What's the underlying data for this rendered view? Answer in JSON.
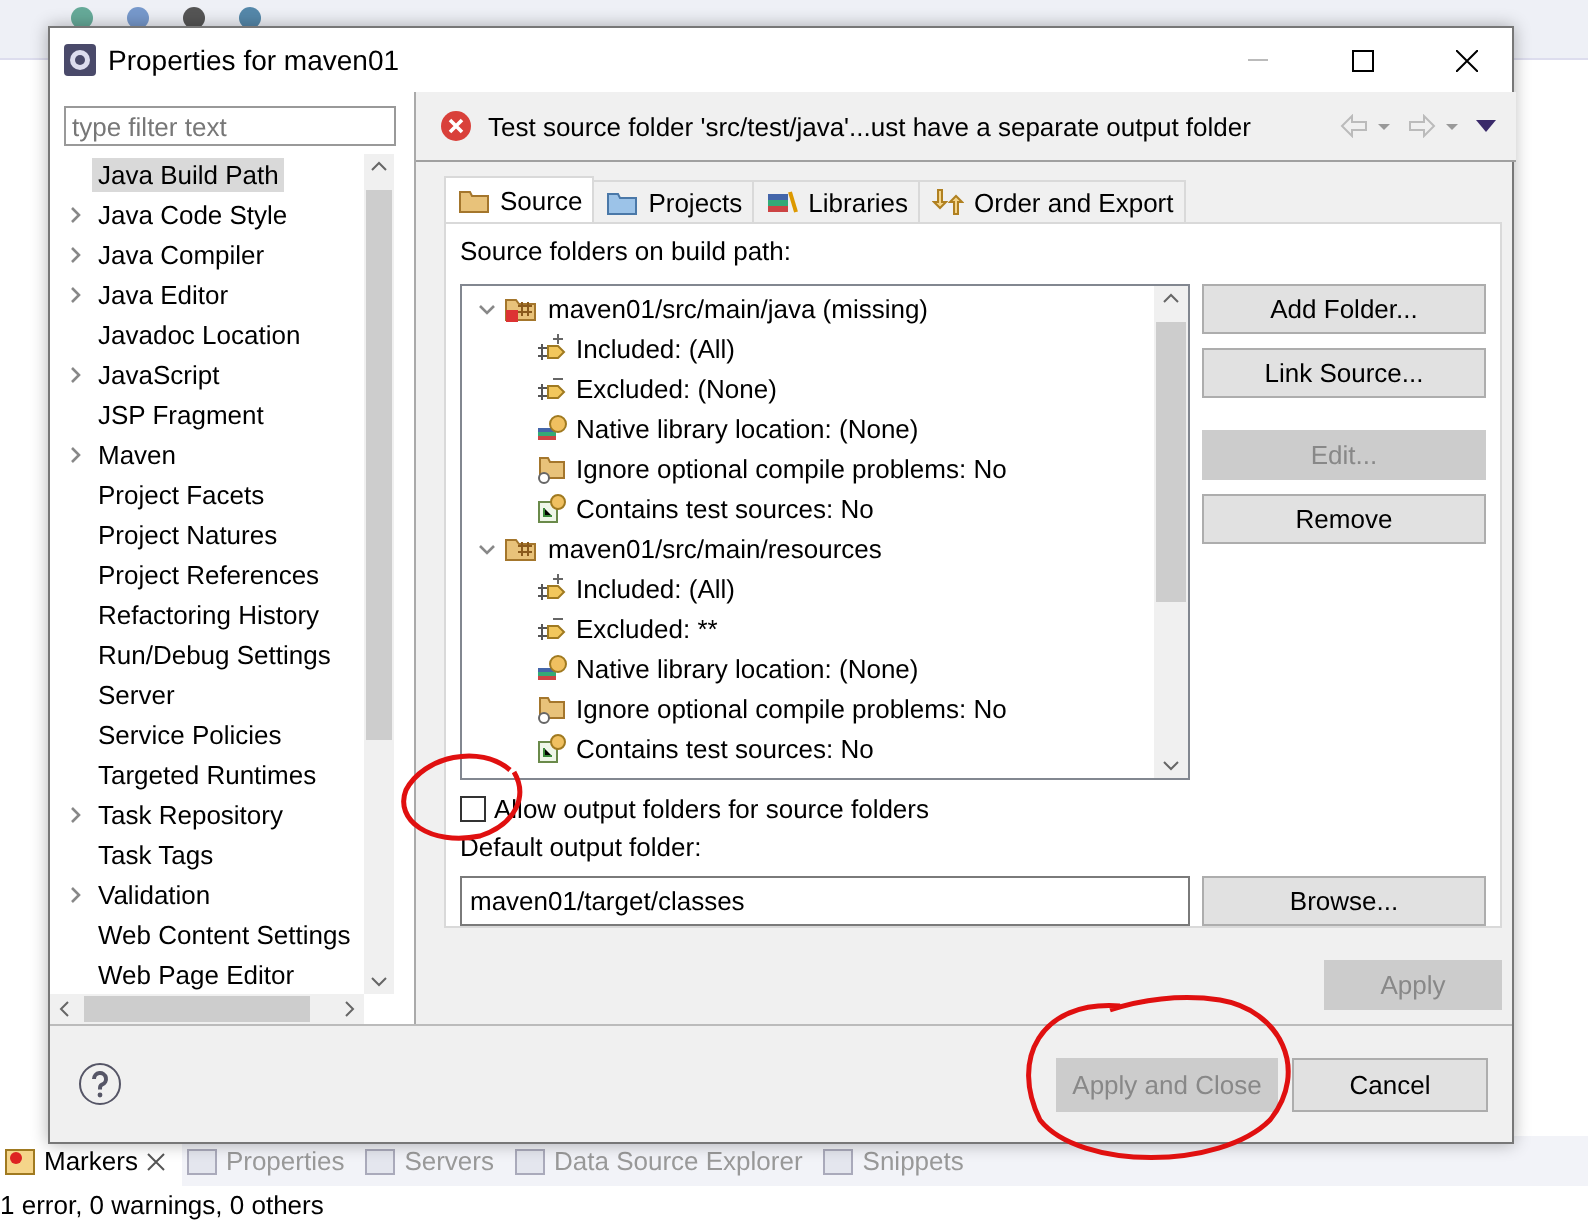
{
  "workbench": {
    "view_tabs": [
      {
        "label": "Markers",
        "selected": true
      },
      {
        "label": "Properties",
        "selected": false
      },
      {
        "label": "Servers",
        "selected": false
      },
      {
        "label": "Data Source Explorer",
        "selected": false
      },
      {
        "label": "Snippets",
        "selected": false
      }
    ],
    "status": "1 error, 0 warnings, 0 others"
  },
  "dialog": {
    "title": "Properties for maven01",
    "filter": {
      "placeholder": "type filter text"
    },
    "nav": [
      {
        "label": "Java Build Path",
        "expandable": false,
        "selected": true
      },
      {
        "label": "Java Code Style",
        "expandable": true,
        "selected": false
      },
      {
        "label": "Java Compiler",
        "expandable": true,
        "selected": false
      },
      {
        "label": "Java Editor",
        "expandable": true,
        "selected": false
      },
      {
        "label": "Javadoc Location",
        "expandable": false,
        "selected": false
      },
      {
        "label": "JavaScript",
        "expandable": true,
        "selected": false
      },
      {
        "label": "JSP Fragment",
        "expandable": false,
        "selected": false
      },
      {
        "label": "Maven",
        "expandable": true,
        "selected": false
      },
      {
        "label": "Project Facets",
        "expandable": false,
        "selected": false
      },
      {
        "label": "Project Natures",
        "expandable": false,
        "selected": false
      },
      {
        "label": "Project References",
        "expandable": false,
        "selected": false
      },
      {
        "label": "Refactoring History",
        "expandable": false,
        "selected": false
      },
      {
        "label": "Run/Debug Settings",
        "expandable": false,
        "selected": false
      },
      {
        "label": "Server",
        "expandable": false,
        "selected": false
      },
      {
        "label": "Service Policies",
        "expandable": false,
        "selected": false
      },
      {
        "label": "Targeted Runtimes",
        "expandable": false,
        "selected": false
      },
      {
        "label": "Task Repository",
        "expandable": true,
        "selected": false
      },
      {
        "label": "Task Tags",
        "expandable": false,
        "selected": false
      },
      {
        "label": "Validation",
        "expandable": true,
        "selected": false
      },
      {
        "label": "Web Content Settings",
        "expandable": false,
        "selected": false
      },
      {
        "label": "Web Page Editor",
        "expandable": false,
        "selected": false
      }
    ],
    "message": "Test source folder 'src/test/java'...ust have a separate output folder",
    "tabs": [
      {
        "label": "Source",
        "kind": "source",
        "selected": true
      },
      {
        "label": "Projects",
        "kind": "projects",
        "selected": false
      },
      {
        "label": "Libraries",
        "kind": "libraries",
        "selected": false
      },
      {
        "label": "Order and Export",
        "kind": "order",
        "selected": false
      }
    ],
    "source_label": "Source folders on build path:",
    "source_tree": [
      {
        "label": "maven01/src/main/java (missing)",
        "missing": true,
        "expanded": true,
        "children": [
          {
            "kind": "included",
            "label": "Included: (All)"
          },
          {
            "kind": "excluded",
            "label": "Excluded: (None)"
          },
          {
            "kind": "native",
            "label": "Native library location: (None)"
          },
          {
            "kind": "ignore",
            "label": "Ignore optional compile problems: No"
          },
          {
            "kind": "test",
            "label": "Contains test sources: No"
          }
        ]
      },
      {
        "label": "maven01/src/main/resources",
        "missing": false,
        "expanded": true,
        "children": [
          {
            "kind": "included",
            "label": "Included: (All)"
          },
          {
            "kind": "excluded",
            "label": "Excluded: **"
          },
          {
            "kind": "native",
            "label": "Native library location: (None)"
          },
          {
            "kind": "ignore",
            "label": "Ignore optional compile problems: No"
          },
          {
            "kind": "test",
            "label": "Contains test sources: No"
          }
        ]
      }
    ],
    "side_buttons": [
      {
        "label": "Add Folder...",
        "disabled": false
      },
      {
        "label": "Link Source...",
        "disabled": false
      },
      {
        "label": "Edit...",
        "disabled": true
      },
      {
        "label": "Remove",
        "disabled": false
      }
    ],
    "allow_output": {
      "label": "Allow output folders for source folders",
      "checked": false
    },
    "output_label": "Default output folder:",
    "output_folder": {
      "value": "maven01/target/classes"
    },
    "browse": "Browse...",
    "apply": {
      "label": "Apply",
      "disabled": true
    },
    "footer_buttons": [
      {
        "label": "Apply and Close",
        "disabled": true
      },
      {
        "label": "Cancel",
        "disabled": false
      }
    ]
  }
}
